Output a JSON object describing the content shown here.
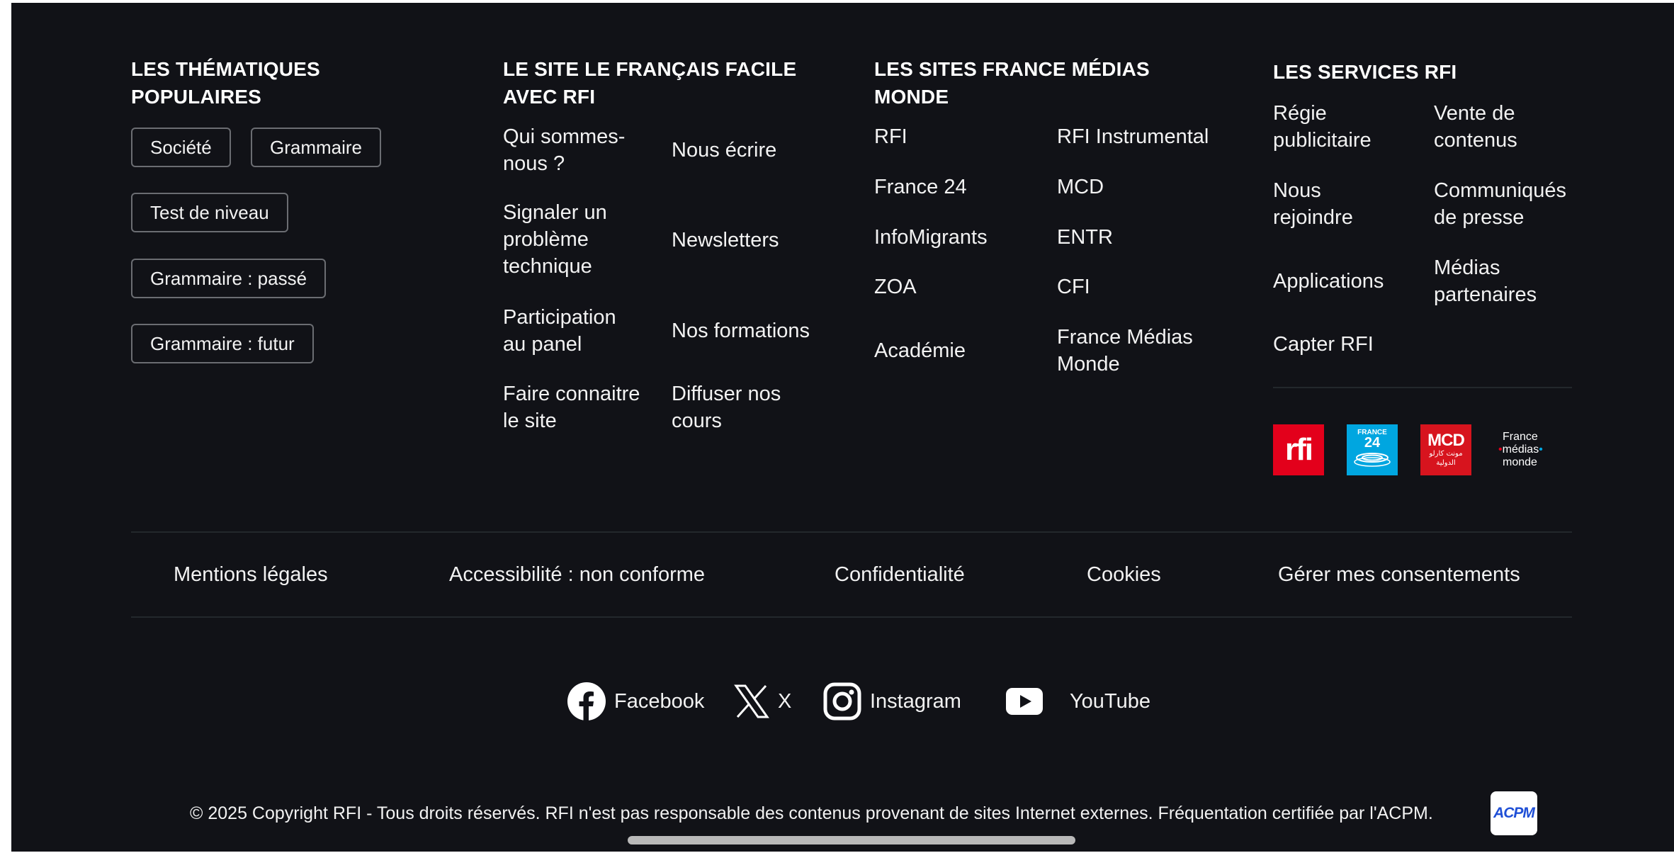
{
  "columns": {
    "popular": {
      "title_line1": "LES THÉMATIQUES",
      "title_line2": "POPULAIRES",
      "tags": [
        "Société",
        "Grammaire",
        "Test de niveau",
        "Grammaire : passé",
        "Grammaire : futur"
      ]
    },
    "site": {
      "title_line1": "LE SITE LE FRANÇAIS FACILE",
      "title_line2": "AVEC RFI",
      "links": [
        [
          "Qui sommes-",
          "nous ?"
        ],
        [
          "Nous écrire"
        ],
        [
          "Signaler un",
          "problème",
          "technique"
        ],
        [
          "Newsletters"
        ],
        [
          "Participation",
          "au panel"
        ],
        [
          "Nos formations"
        ],
        [
          "Faire connaitre",
          "le site"
        ],
        [
          "Diffuser nos",
          "cours"
        ]
      ]
    },
    "sites": {
      "title_line1": "LES SITES FRANCE MÉDIAS",
      "title_line2": "MONDE",
      "links": [
        [
          "RFI"
        ],
        [
          "RFI Instrumental"
        ],
        [
          "France 24"
        ],
        [
          "MCD"
        ],
        [
          "InfoMigrants"
        ],
        [
          "ENTR"
        ],
        [
          "ZOA"
        ],
        [
          "CFI"
        ],
        [
          "Académie"
        ],
        [
          "France Médias",
          "Monde"
        ]
      ]
    },
    "services": {
      "title": "LES SERVICES RFI",
      "links": [
        [
          "Régie",
          "publicitaire"
        ],
        [
          "Vente de",
          "contenus"
        ],
        [
          "Nous",
          "rejoindre"
        ],
        [
          "Communiqués",
          "de presse"
        ],
        [
          "Applications"
        ],
        [
          "Médias",
          "partenaires"
        ],
        [
          "Capter RFI"
        ]
      ],
      "logos": {
        "rfi": "rfi",
        "france24_top": "FRANCE",
        "france24_num": "24",
        "mcd": "MCD",
        "mcd_arabic_1": "مونت كارلو",
        "mcd_arabic_2": "الدولية",
        "fmm_1": "France",
        "fmm_2": "médias",
        "fmm_3": "monde"
      }
    }
  },
  "legal": [
    "Mentions légales",
    "Accessibilité : non conforme",
    "Confidentialité",
    "Cookies",
    "Gérer mes consentements"
  ],
  "social": {
    "facebook": "Facebook",
    "x": "X",
    "instagram": "Instagram",
    "youtube": "YouTube"
  },
  "copyright": "© 2025 Copyright RFI - Tous droits réservés. RFI n'est pas responsable des contenus provenant de sites Internet externes. Fréquentation certifiée par l'ACPM.",
  "acpm": "ACPM",
  "colors": {
    "background": "#111217",
    "rfi_red": "#e3001b",
    "france24_blue": "#00a6e0",
    "mcd_red": "#d7141e"
  }
}
